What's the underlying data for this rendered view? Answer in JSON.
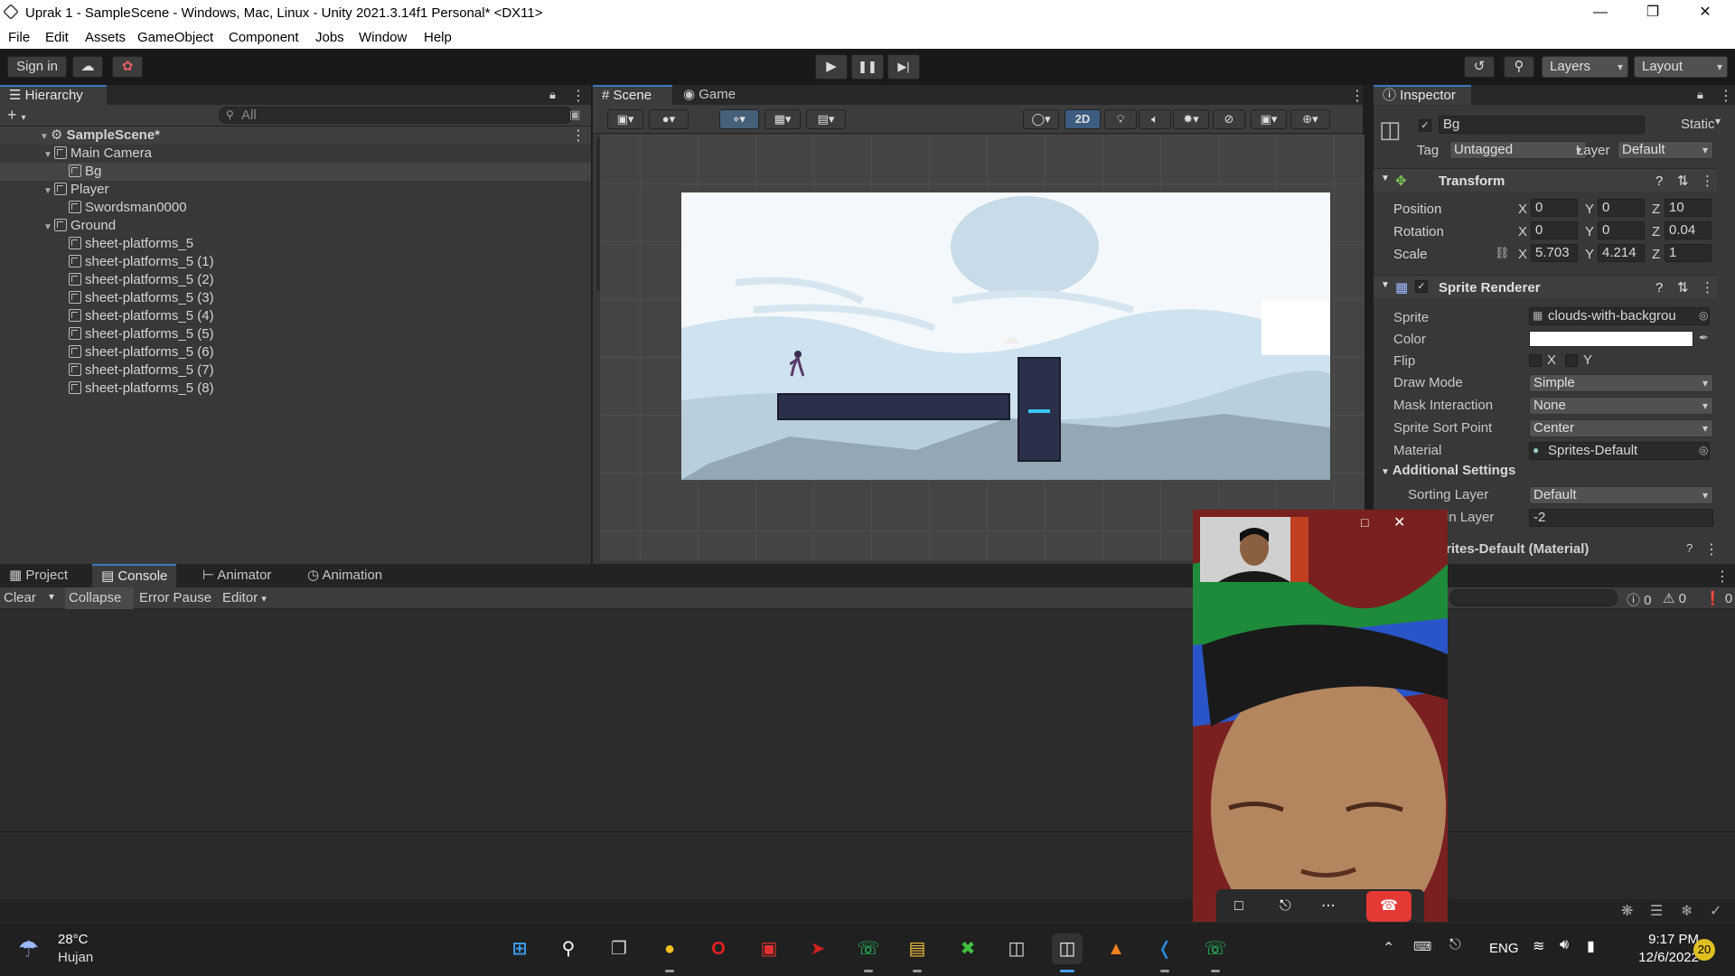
{
  "window": {
    "title": "Uprak 1 - SampleScene - Windows, Mac, Linux - Unity 2021.3.14f1 Personal* <DX11>"
  },
  "menu": [
    "File",
    "Edit",
    "Assets",
    "GameObject",
    "Component",
    "Jobs",
    "Window",
    "Help"
  ],
  "toolbar": {
    "sign_in": "Sign in",
    "layers": "Layers",
    "layout": "Layout"
  },
  "hierarchy": {
    "tab": "Hierarchy",
    "search_placeholder": "All",
    "scene": "SampleScene*",
    "items": [
      {
        "label": "Main Camera",
        "indent": 1,
        "expand": true
      },
      {
        "label": "Bg",
        "indent": 2,
        "selected": true
      },
      {
        "label": "Player",
        "indent": 1,
        "expand": true
      },
      {
        "label": "Swordsman0000",
        "indent": 2
      },
      {
        "label": "Ground",
        "indent": 1,
        "expand": true
      },
      {
        "label": "sheet-platforms_5",
        "indent": 2
      },
      {
        "label": "sheet-platforms_5 (1)",
        "indent": 2
      },
      {
        "label": "sheet-platforms_5 (2)",
        "indent": 2
      },
      {
        "label": "sheet-platforms_5 (3)",
        "indent": 2
      },
      {
        "label": "sheet-platforms_5 (4)",
        "indent": 2
      },
      {
        "label": "sheet-platforms_5 (5)",
        "indent": 2
      },
      {
        "label": "sheet-platforms_5 (6)",
        "indent": 2
      },
      {
        "label": "sheet-platforms_5 (7)",
        "indent": 2
      },
      {
        "label": "sheet-platforms_5 (8)",
        "indent": 2
      }
    ]
  },
  "scene": {
    "tab_scene": "Scene",
    "tab_game": "Game",
    "mode_2d": "2D"
  },
  "inspector": {
    "tab": "Inspector",
    "object_name": "Bg",
    "static": "Static",
    "tag_label": "Tag",
    "tag": "Untagged",
    "layer_label": "Layer",
    "layer": "Default",
    "transform": {
      "title": "Transform",
      "position_label": "Position",
      "rotation_label": "Rotation",
      "scale_label": "Scale",
      "position": {
        "x": "0",
        "y": "0",
        "z": "10"
      },
      "rotation": {
        "x": "0",
        "y": "0",
        "z": "0.04"
      },
      "scale": {
        "x": "5.703",
        "y": "4.214",
        "z": "1"
      }
    },
    "sprite_renderer": {
      "title": "Sprite Renderer",
      "sprite_label": "Sprite",
      "sprite": "clouds-with-backgrou",
      "color_label": "Color",
      "flip_label": "Flip",
      "flip_x": "X",
      "flip_y": "Y",
      "draw_mode_label": "Draw Mode",
      "draw_mode": "Simple",
      "mask_label": "Mask Interaction",
      "mask": "None",
      "sort_point_label": "Sprite Sort Point",
      "sort_point": "Center",
      "material_label": "Material",
      "material": "Sprites-Default"
    },
    "additional": {
      "title": "Additional Settings",
      "sorting_layer_label": "Sorting Layer",
      "sorting_layer": "Default",
      "order_label": "in Layer",
      "order": "-2"
    },
    "material_header": "rites-Default (Material)"
  },
  "bottom": {
    "tabs": [
      "Project",
      "Console",
      "Animator",
      "Animation"
    ],
    "clear": "Clear",
    "collapse": "Collapse",
    "error_pause": "Error Pause",
    "editor": "Editor",
    "count_info": "0",
    "count_warn": "0",
    "count_err": "0"
  },
  "taskbar": {
    "temp": "28°C",
    "weather": "Hujan",
    "lang": "ENG",
    "time": "9:17 PM",
    "date": "12/6/2022",
    "badge": "20"
  },
  "colors": {
    "accent": "#3a79bb",
    "selection": "#2c5d87",
    "call_end": "#e53935"
  }
}
